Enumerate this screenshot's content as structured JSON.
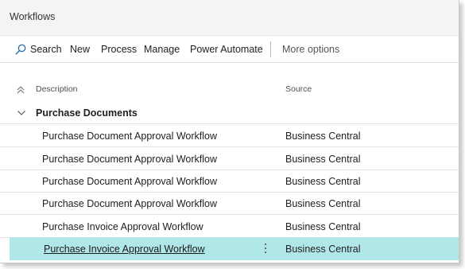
{
  "window": {
    "title": "Workflows"
  },
  "action_bar": {
    "search_label": "Search",
    "new_label": "New",
    "process_label": "Process",
    "manage_label": "Manage",
    "power_automate_label": "Power Automate",
    "more_options_label": "More options"
  },
  "columns": {
    "description": "Description",
    "source": "Source"
  },
  "group": {
    "label": "Purchase Documents"
  },
  "rows": [
    {
      "description": "Purchase Document Approval Workflow",
      "source": "Business Central"
    },
    {
      "description": "Purchase Document Approval Workflow",
      "source": "Business Central"
    },
    {
      "description": "Purchase Document Approval Workflow",
      "source": "Business Central"
    },
    {
      "description": "Purchase Document Approval Workflow",
      "source": "Business Central"
    },
    {
      "description": "Purchase Invoice Approval Workflow",
      "source": "Business Central"
    },
    {
      "description": "Purchase Invoice Approval Workflow",
      "source": "Business Central",
      "selected": true
    }
  ],
  "icons": {
    "search": "search-icon",
    "sort": "sort-ascending-icon",
    "group_toggle": "chevron-down-icon",
    "row_menu": "more-vertical-icon"
  },
  "colors": {
    "selected_row": "#b2e7ea",
    "title_bar": "#f4f4f4"
  }
}
